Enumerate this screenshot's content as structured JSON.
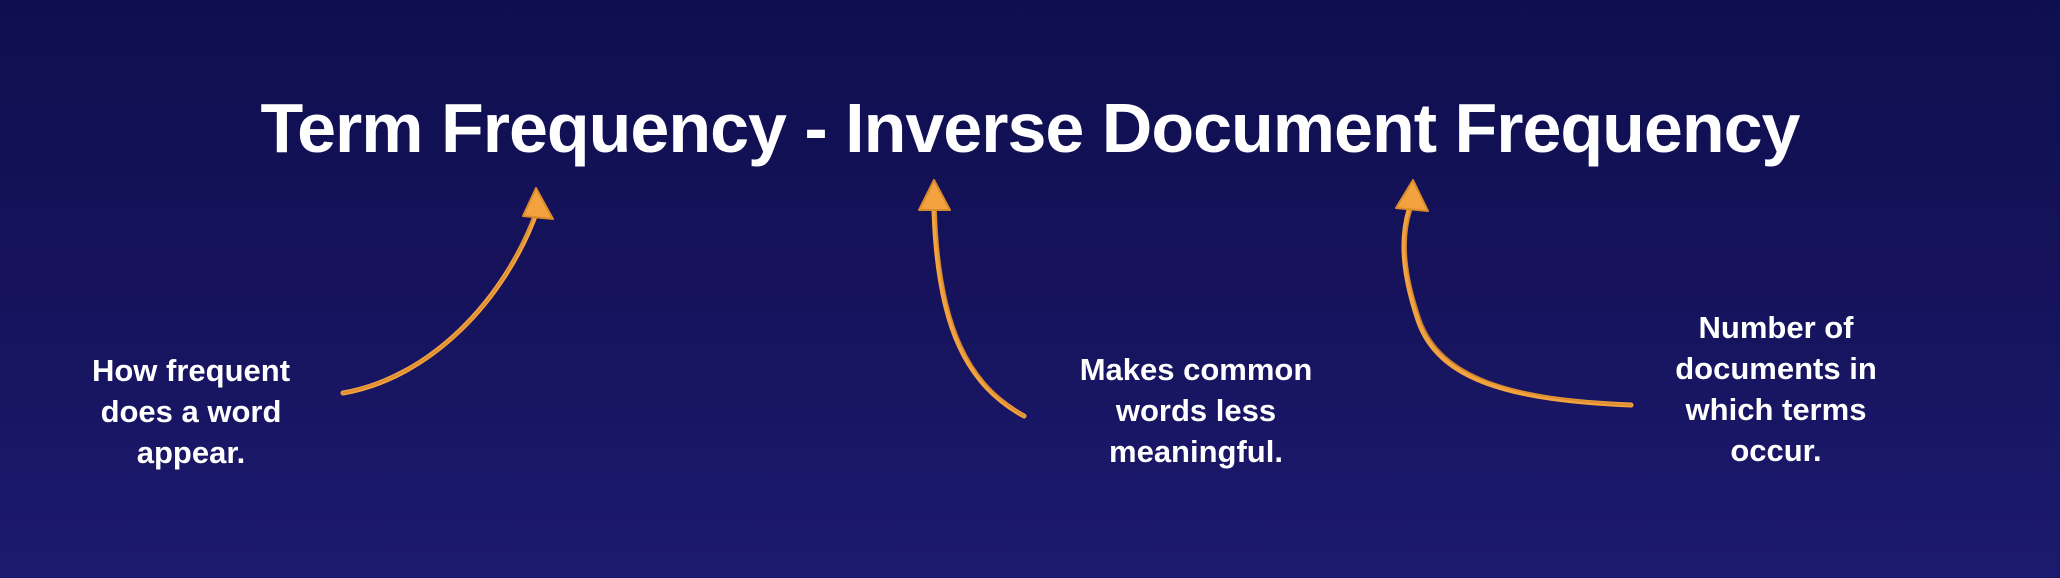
{
  "title": "Term Frequency - Inverse Document Frequency",
  "annotations": [
    {
      "id": "tf",
      "lines": [
        "How frequent",
        "does a word",
        "appear."
      ]
    },
    {
      "id": "idf",
      "lines": [
        "Makes common",
        "words less",
        "meaningful."
      ]
    },
    {
      "id": "df",
      "lines": [
        "Number of",
        "documents in",
        "which terms",
        "occur."
      ]
    }
  ],
  "colors": {
    "background_top": "#0f0f4f",
    "background_bottom": "#1c1a6e",
    "text": "#ffffff",
    "arrow": "#f2a340"
  },
  "icons": [
    "arrow-up-icon"
  ]
}
